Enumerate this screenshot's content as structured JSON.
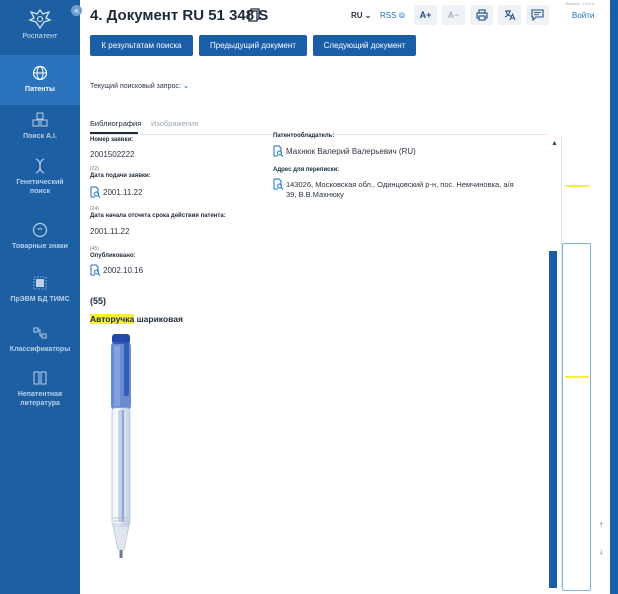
{
  "sidebar": {
    "logo_text": "Роспатент",
    "items": [
      {
        "label": "Патенты",
        "icon": "globe-icon"
      },
      {
        "label": "Поиск A.I.",
        "icon": "cubes-icon"
      },
      {
        "label": "Генетический поиск",
        "icon": "dna-icon"
      },
      {
        "label": "Товарные знаки",
        "icon": "trademark-icon"
      },
      {
        "label": "ПрЭВМ БД ТИМС",
        "icon": "chip-icon"
      },
      {
        "label": "Классификаторы",
        "icon": "hierarchy-icon"
      },
      {
        "label": "Непатентная литература",
        "icon": "books-icon"
      }
    ]
  },
  "header": {
    "title": "4. Документ RU 51 348 S",
    "lang": "RU",
    "rss": "RSS",
    "font_increase": "A+",
    "font_decrease": "A−",
    "version": "Версия: 1.0.0.0",
    "login": "Войти"
  },
  "nav": {
    "back": "К результатам поиска",
    "prev": "Предыдущий документ",
    "next": "Следующий документ"
  },
  "query_label": "Текущий поисковый запрос:",
  "tabs": {
    "bibliography": "Библиография",
    "images": "Изображения"
  },
  "fields": {
    "app_number_label": "Номер заявки:",
    "app_number": "2001502222",
    "filing_code": "(22)",
    "filing_label": "Дата подачи заявки:",
    "filing_date": "2001.11.22",
    "start_code": "(24)",
    "start_label": "Дата начала отсчета срока действия патента:",
    "start_date": "2001.11.22",
    "pub_code": "(45)",
    "pub_label": "Опубликовано:",
    "pub_date": "2002.10.16",
    "owner_label": "Патентообладатель:",
    "owner": "Махнюк Валерий Валерьевич (RU)",
    "address_label": "Адрес для переписки:",
    "address_line1": "143026, Московская обл., Одинцовский р-н, пос. Немчиновка, а/я",
    "address_line2": "39, В.В.Махнюку"
  },
  "section_55": "(55)",
  "design_title_highlight": "Авторучка",
  "design_title_rest": " шариковая",
  "colors": {
    "sidebar": "#1d5fa3",
    "accent": "#1b5ea8",
    "highlight": "#f5ef37"
  }
}
